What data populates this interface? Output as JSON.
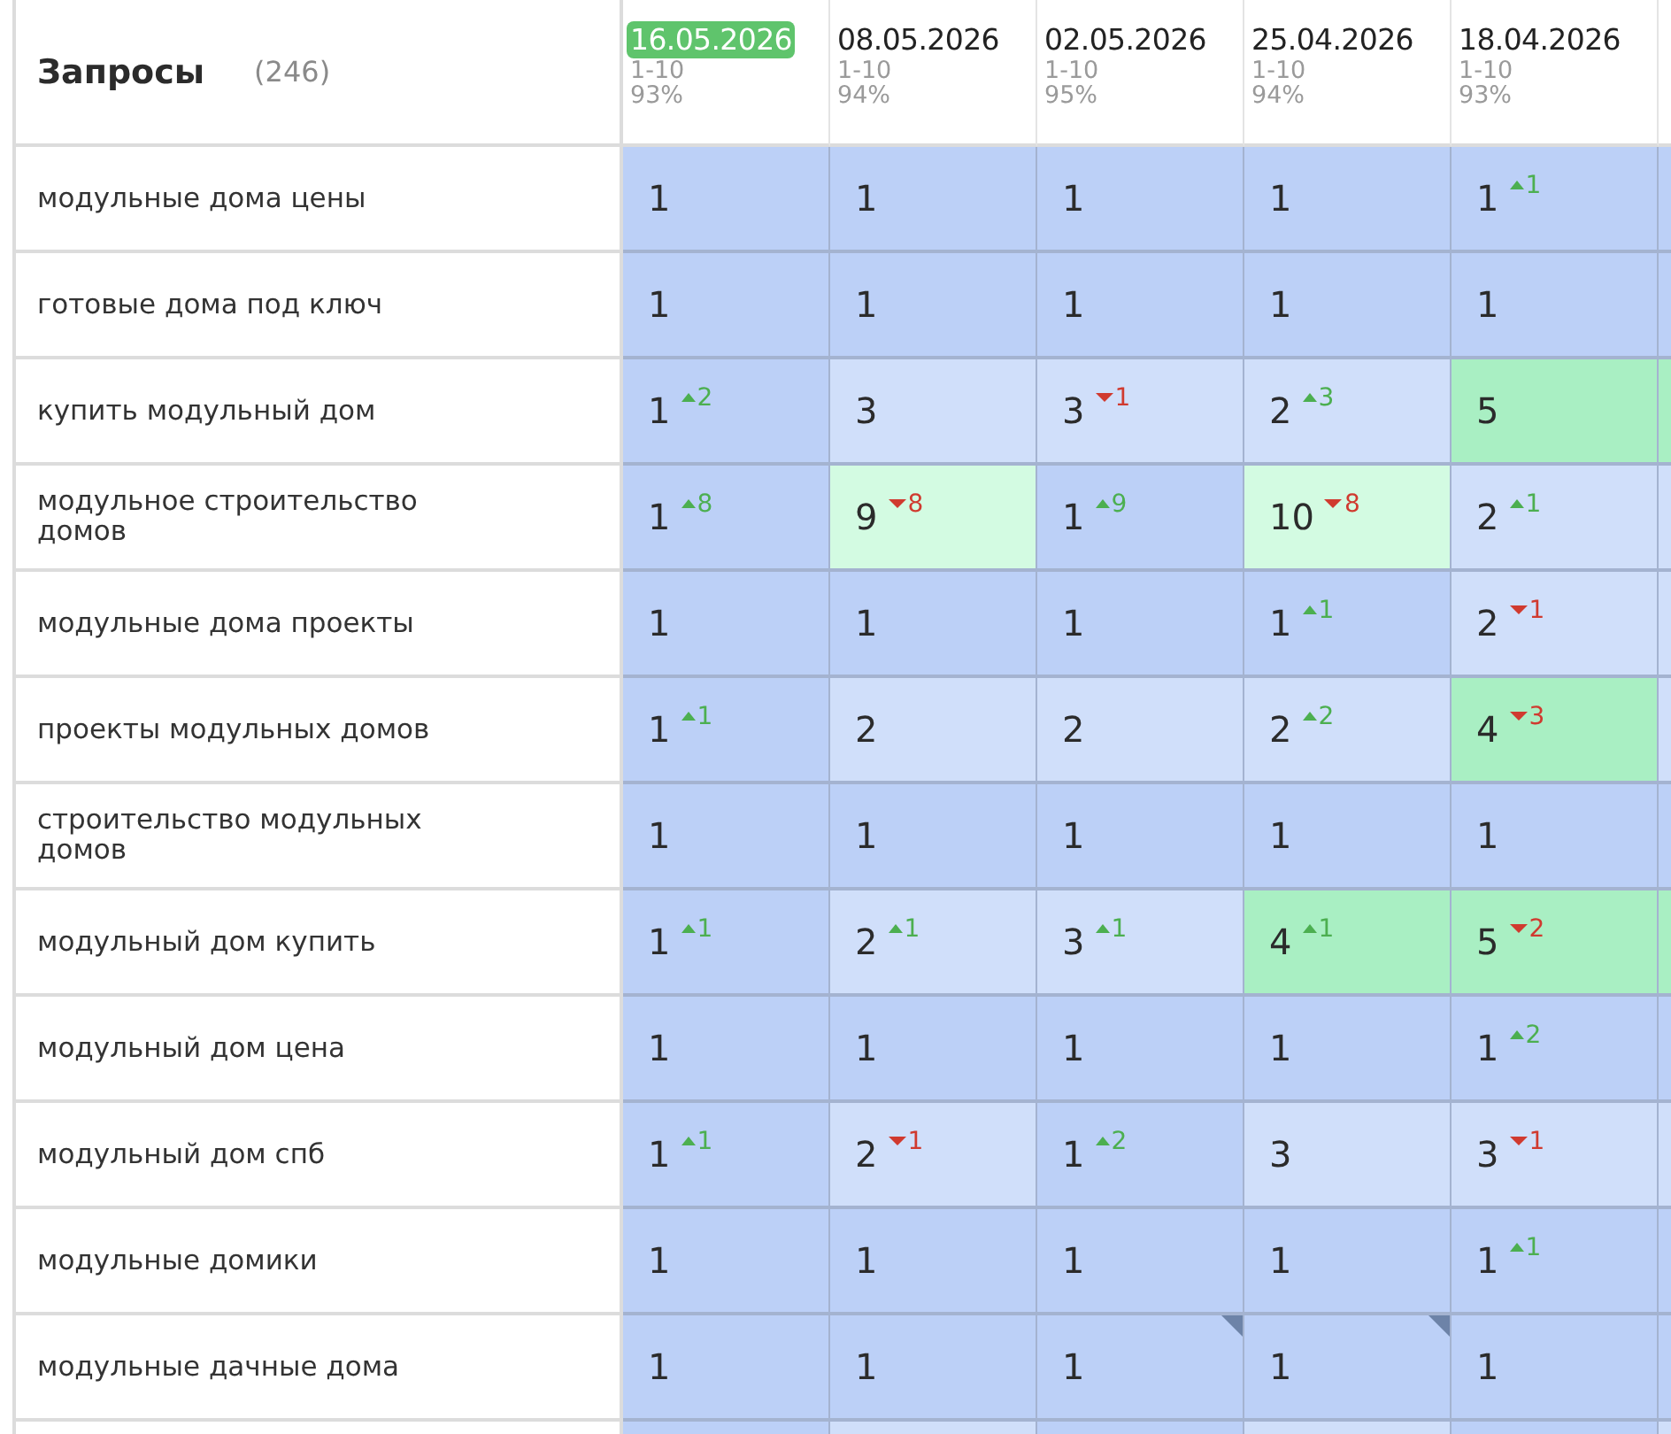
{
  "header": {
    "title": "Запросы",
    "count": "(246)"
  },
  "dates": [
    {
      "date": "16.05.2026",
      "selected": true,
      "range": "1-10",
      "percent": "93%"
    },
    {
      "date": "08.05.2026",
      "selected": false,
      "range": "1-10",
      "percent": "94%"
    },
    {
      "date": "02.05.2026",
      "selected": false,
      "range": "1-10",
      "percent": "95%"
    },
    {
      "date": "25.04.2026",
      "selected": false,
      "range": "1-10",
      "percent": "94%"
    },
    {
      "date": "18.04.2026",
      "selected": false,
      "range": "1-10",
      "percent": "93%"
    }
  ],
  "rows": [
    {
      "query": "модульные дома цены",
      "cells": [
        {
          "value": "1",
          "color": "#bcd0f7"
        },
        {
          "value": "1",
          "color": "#bcd0f7"
        },
        {
          "value": "1",
          "color": "#bcd0f7"
        },
        {
          "value": "1",
          "color": "#bcd0f7"
        },
        {
          "value": "1",
          "color": "#bcd0f7",
          "delta": "1",
          "up": true
        }
      ],
      "cut_cell": {
        "color": "#bcd0f7"
      }
    },
    {
      "query": "готовые дома под ключ",
      "cells": [
        {
          "value": "1",
          "color": "#bcd0f7"
        },
        {
          "value": "1",
          "color": "#bcd0f7"
        },
        {
          "value": "1",
          "color": "#bcd0f7"
        },
        {
          "value": "1",
          "color": "#bcd0f7"
        },
        {
          "value": "1",
          "color": "#bcd0f7"
        }
      ],
      "cut_cell": {
        "color": "#bcd0f7"
      }
    },
    {
      "query": "купить модульный дом",
      "cells": [
        {
          "value": "1",
          "color": "#bcd0f7",
          "delta": "2",
          "up": true
        },
        {
          "value": "3",
          "color": "#d0dffa"
        },
        {
          "value": "3",
          "color": "#d0dffa",
          "delta": "1",
          "up": false
        },
        {
          "value": "2",
          "color": "#d0dffa",
          "delta": "3",
          "up": true
        },
        {
          "value": "5",
          "color": "#a9efc3"
        }
      ],
      "cut_cell": {
        "color": "#a9efc3"
      }
    },
    {
      "query": "модульное строительство домов",
      "cells": [
        {
          "value": "1",
          "color": "#bcd0f7",
          "delta": "8",
          "up": true
        },
        {
          "value": "9",
          "color": "#d3fbe2",
          "delta": "8",
          "up": false
        },
        {
          "value": "1",
          "color": "#bcd0f7",
          "delta": "9",
          "up": true
        },
        {
          "value": "10",
          "color": "#d3fbe2",
          "delta": "8",
          "up": false
        },
        {
          "value": "2",
          "color": "#d0dffa",
          "delta": "1",
          "up": true
        }
      ],
      "cut_cell": {
        "color": "#d0dffa"
      }
    },
    {
      "query": "модульные дома проекты",
      "cells": [
        {
          "value": "1",
          "color": "#bcd0f7"
        },
        {
          "value": "1",
          "color": "#bcd0f7"
        },
        {
          "value": "1",
          "color": "#bcd0f7"
        },
        {
          "value": "1",
          "color": "#bcd0f7",
          "delta": "1",
          "up": true
        },
        {
          "value": "2",
          "color": "#d0dffa",
          "delta": "1",
          "up": false
        }
      ],
      "cut_cell": {
        "color": "#d0dffa"
      }
    },
    {
      "query": "проекты модульных домов",
      "cells": [
        {
          "value": "1",
          "color": "#bcd0f7",
          "delta": "1",
          "up": true
        },
        {
          "value": "2",
          "color": "#d0dffa"
        },
        {
          "value": "2",
          "color": "#d0dffa"
        },
        {
          "value": "2",
          "color": "#d0dffa",
          "delta": "2",
          "up": true
        },
        {
          "value": "4",
          "color": "#a9efc3",
          "delta": "3",
          "up": false
        }
      ],
      "cut_cell": {
        "color": "#d0dffa"
      }
    },
    {
      "query": "строительство модульных домов",
      "cells": [
        {
          "value": "1",
          "color": "#bcd0f7"
        },
        {
          "value": "1",
          "color": "#bcd0f7"
        },
        {
          "value": "1",
          "color": "#bcd0f7"
        },
        {
          "value": "1",
          "color": "#bcd0f7"
        },
        {
          "value": "1",
          "color": "#bcd0f7"
        }
      ],
      "cut_cell": {
        "color": "#bcd0f7"
      }
    },
    {
      "query": "модульный дом купить",
      "cells": [
        {
          "value": "1",
          "color": "#bcd0f7",
          "delta": "1",
          "up": true
        },
        {
          "value": "2",
          "color": "#d0dffa",
          "delta": "1",
          "up": true
        },
        {
          "value": "3",
          "color": "#d0dffa",
          "delta": "1",
          "up": true
        },
        {
          "value": "4",
          "color": "#a9efc3",
          "delta": "1",
          "up": true
        },
        {
          "value": "5",
          "color": "#a9efc3",
          "delta": "2",
          "up": false
        }
      ],
      "cut_cell": {
        "color": "#a9efc3"
      }
    },
    {
      "query": "модульный дом цена",
      "cells": [
        {
          "value": "1",
          "color": "#bcd0f7"
        },
        {
          "value": "1",
          "color": "#bcd0f7"
        },
        {
          "value": "1",
          "color": "#bcd0f7"
        },
        {
          "value": "1",
          "color": "#bcd0f7"
        },
        {
          "value": "1",
          "color": "#bcd0f7",
          "delta": "2",
          "up": true
        }
      ],
      "cut_cell": {
        "color": "#bcd0f7"
      }
    },
    {
      "query": "модульный дом спб",
      "cells": [
        {
          "value": "1",
          "color": "#bcd0f7",
          "delta": "1",
          "up": true
        },
        {
          "value": "2",
          "color": "#d0dffa",
          "delta": "1",
          "up": false
        },
        {
          "value": "1",
          "color": "#bcd0f7",
          "delta": "2",
          "up": true
        },
        {
          "value": "3",
          "color": "#d0dffa"
        },
        {
          "value": "3",
          "color": "#d0dffa",
          "delta": "1",
          "up": false
        }
      ],
      "cut_cell": {
        "color": "#d0dffa"
      }
    },
    {
      "query": "модульные домики",
      "cells": [
        {
          "value": "1",
          "color": "#bcd0f7"
        },
        {
          "value": "1",
          "color": "#bcd0f7"
        },
        {
          "value": "1",
          "color": "#bcd0f7"
        },
        {
          "value": "1",
          "color": "#bcd0f7"
        },
        {
          "value": "1",
          "color": "#bcd0f7",
          "delta": "1",
          "up": true
        }
      ],
      "cut_cell": {
        "color": "#bcd0f7"
      }
    },
    {
      "query": "модульные дачные дома",
      "cells": [
        {
          "value": "1",
          "color": "#bcd0f7"
        },
        {
          "value": "1",
          "color": "#bcd0f7"
        },
        {
          "value": "1",
          "color": "#bcd0f7",
          "note": true
        },
        {
          "value": "1",
          "color": "#bcd0f7",
          "note": true
        },
        {
          "value": "1",
          "color": "#bcd0f7"
        }
      ],
      "cut_cell": {
        "color": "#bcd0f7"
      }
    }
  ]
}
